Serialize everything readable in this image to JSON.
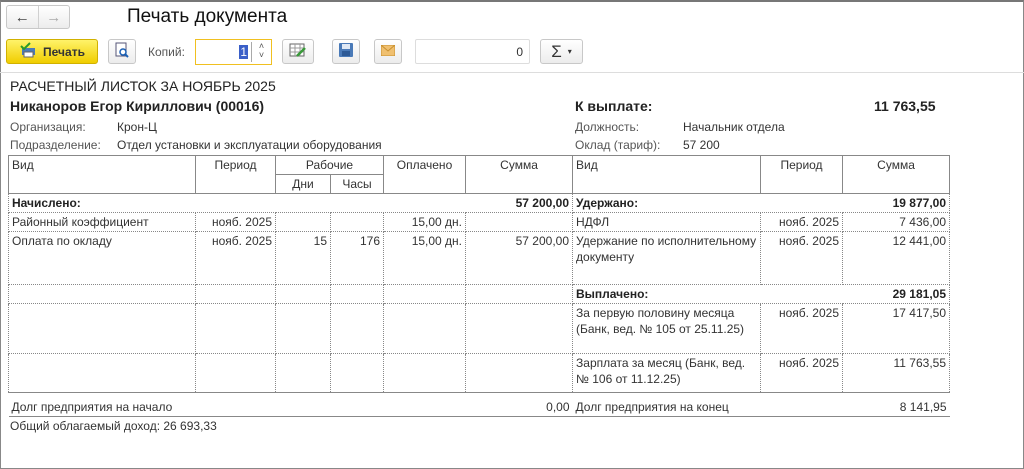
{
  "window": {
    "title": "Печать документа",
    "back": "←",
    "forward": "→"
  },
  "toolbar": {
    "print_label": "Печать",
    "copies_label": "Копий:",
    "copies_value": "1",
    "spin_up": "˄",
    "spin_down": "˅",
    "counter_value": "0",
    "sum_label": "Σ",
    "sum_arrow": "▾"
  },
  "doc": {
    "heading": "РАСЧЕТНЫЙ ЛИСТОК ЗА НОЯБРЬ 2025",
    "employee": "Никаноров Егор Кириллович (00016)",
    "to_pay_label": "К выплате:",
    "to_pay_value": "11 763,55",
    "org_label": "Организация:",
    "org_value": "Крон-Ц",
    "dept_label": "Подразделение:",
    "dept_value": "Отдел установки и эксплуатации оборудования",
    "pos_label": "Должность:",
    "pos_value": "Начальник отдела",
    "rate_label": "Оклад (тариф):",
    "rate_value": "57 200",
    "cols": {
      "kind": "Вид",
      "period": "Период",
      "work": "Рабочие",
      "days": "Дни",
      "hours": "Часы",
      "paid": "Оплачено",
      "sum": "Сумма",
      "kind2": "Вид",
      "period2": "Период",
      "sum2": "Сумма"
    },
    "accrued_label": "Начислено:",
    "accrued_total": "57 200,00",
    "withheld_label": "Удержано:",
    "withheld_total": "19 877,00",
    "accruals": [
      {
        "kind": "Районный коэффициент",
        "period": "нояб. 2025",
        "days": "",
        "hours": "",
        "paid": "15,00 дн.",
        "sum": ""
      },
      {
        "kind": "Оплата по окладу",
        "period": "нояб. 2025",
        "days": "15",
        "hours": "176",
        "paid": "15,00 дн.",
        "sum": "57 200,00"
      }
    ],
    "withholdings": [
      {
        "kind": "НДФЛ",
        "period": "нояб. 2025",
        "sum": "7 436,00"
      },
      {
        "kind": "Удержание по исполнительному документу",
        "period": "нояб. 2025",
        "sum": "12 441,00"
      }
    ],
    "paid_out_label": "Выплачено:",
    "paid_out_total": "29 181,05",
    "payments": [
      {
        "kind": "За первую половину месяца (Банк, вед. № 105 от 25.11.25)",
        "period": "нояб. 2025",
        "sum": "17 417,50"
      },
      {
        "kind": "Зарплата за месяц (Банк, вед. № 106 от 11.12.25)",
        "period": "нояб. 2025",
        "sum": "11 763,55"
      }
    ],
    "debt_start_label": "Долг предприятия на начало",
    "debt_start_value": "0,00",
    "debt_end_label": "Долг предприятия на конец",
    "debt_end_value": "8 141,95",
    "taxable_income": "Общий облагаемый доход: 26 693,33"
  }
}
